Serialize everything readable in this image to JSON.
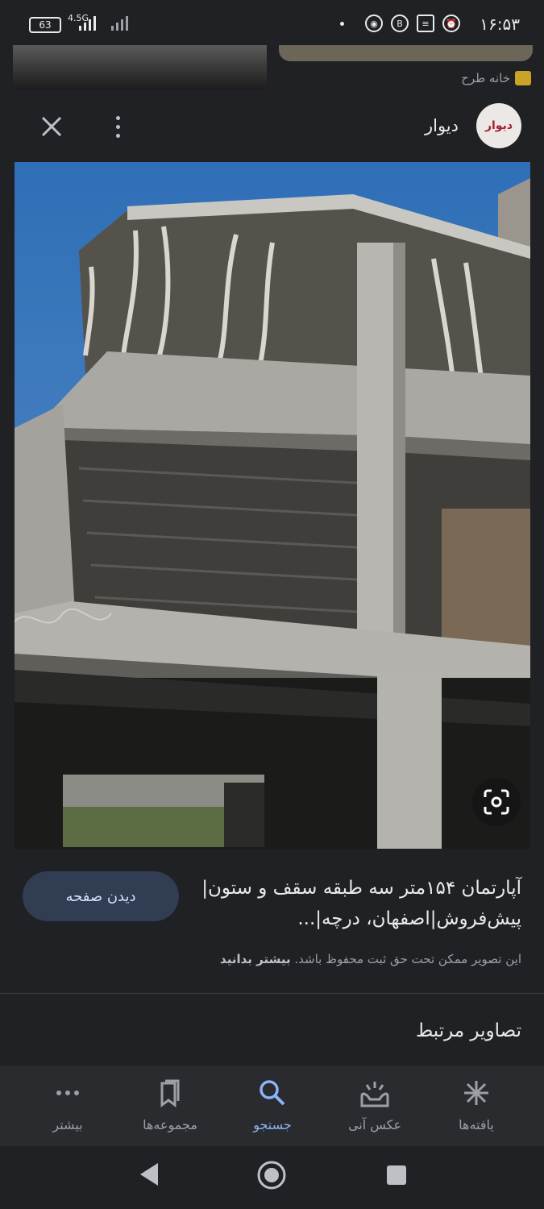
{
  "status_bar": {
    "time": "۱۶:۵۳",
    "battery": "63",
    "network": "4.5G",
    "icons": [
      "alarm-icon",
      "notes-icon",
      "b-icon",
      "chrome-icon",
      "dot-icon"
    ]
  },
  "source": {
    "label": "خانه طرح"
  },
  "header": {
    "site_name": "دیوار",
    "logo_text": "دیوار"
  },
  "result": {
    "title": "آپارتمان ۱۵۴متر سه طبقه سقف و ستون|پیش‌فروش|اصفهان، درچه|...",
    "visit_button": "دیدن صفحه",
    "copyright_text": "این تصویر ممکن تحت حق ثبت محفوظ باشد.",
    "learn_more": "بیشتر بدانید"
  },
  "related": {
    "heading": "تصاویر مرتبط"
  },
  "bottom_nav": {
    "items": [
      {
        "label": "یافته‌ها",
        "icon": "asterisk-icon"
      },
      {
        "label": "عکس آنی",
        "icon": "snapshot-icon"
      },
      {
        "label": "جستجو",
        "icon": "search-icon",
        "active": true
      },
      {
        "label": "مجموعه‌ها",
        "icon": "bookmarks-icon"
      },
      {
        "label": "بیشتر",
        "icon": "more-icon"
      }
    ]
  },
  "colors": {
    "background": "#202124",
    "accent": "#8ab4f8",
    "button_bg": "#303d52",
    "nav_bg": "#2a2b2e"
  }
}
